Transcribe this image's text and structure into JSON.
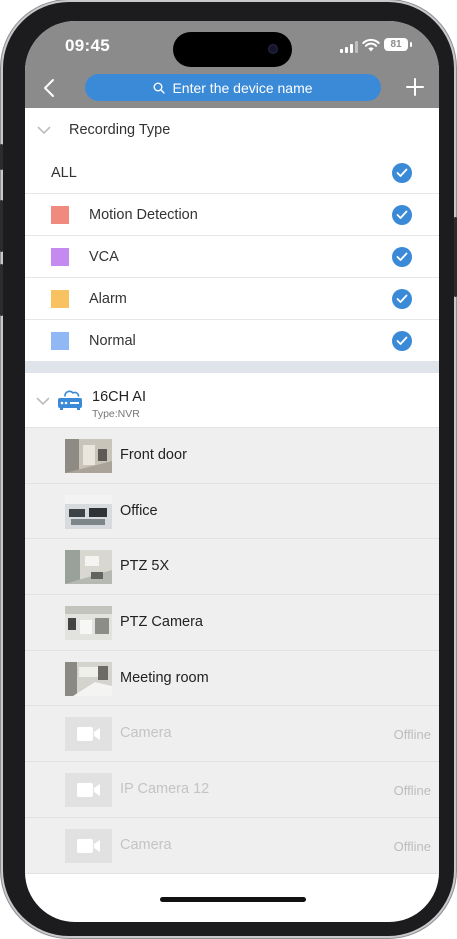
{
  "status_bar": {
    "time": "09:45",
    "battery": "81"
  },
  "nav": {
    "search_placeholder": "Enter the device name"
  },
  "recording_type": {
    "title": "Recording Type",
    "items": [
      {
        "label": "ALL",
        "checked": true
      },
      {
        "label": "Motion Detection",
        "color": "#f08a7e",
        "checked": true
      },
      {
        "label": "VCA",
        "color": "#c58af0",
        "checked": true
      },
      {
        "label": "Alarm",
        "color": "#f7c25f",
        "checked": true
      },
      {
        "label": "Normal",
        "color": "#8fb8f5",
        "checked": true
      }
    ]
  },
  "device": {
    "name": "16CH AI",
    "type": "Type:NVR",
    "icon": "nvr-cloud-icon"
  },
  "cameras": [
    {
      "name": "Front door",
      "online": true
    },
    {
      "name": "Office",
      "online": true
    },
    {
      "name": "PTZ 5X",
      "online": true
    },
    {
      "name": "PTZ Camera",
      "online": true
    },
    {
      "name": "Meeting room",
      "online": true
    },
    {
      "name": "Camera",
      "online": false,
      "status": "Offline"
    },
    {
      "name": "IP Camera 12",
      "online": false,
      "status": "Offline"
    },
    {
      "name": "Camera",
      "online": false,
      "status": "Offline"
    }
  ],
  "colors": {
    "accent": "#3b8ad8",
    "topbar": "#8b8b8b",
    "divider": "#dfe3ea"
  }
}
